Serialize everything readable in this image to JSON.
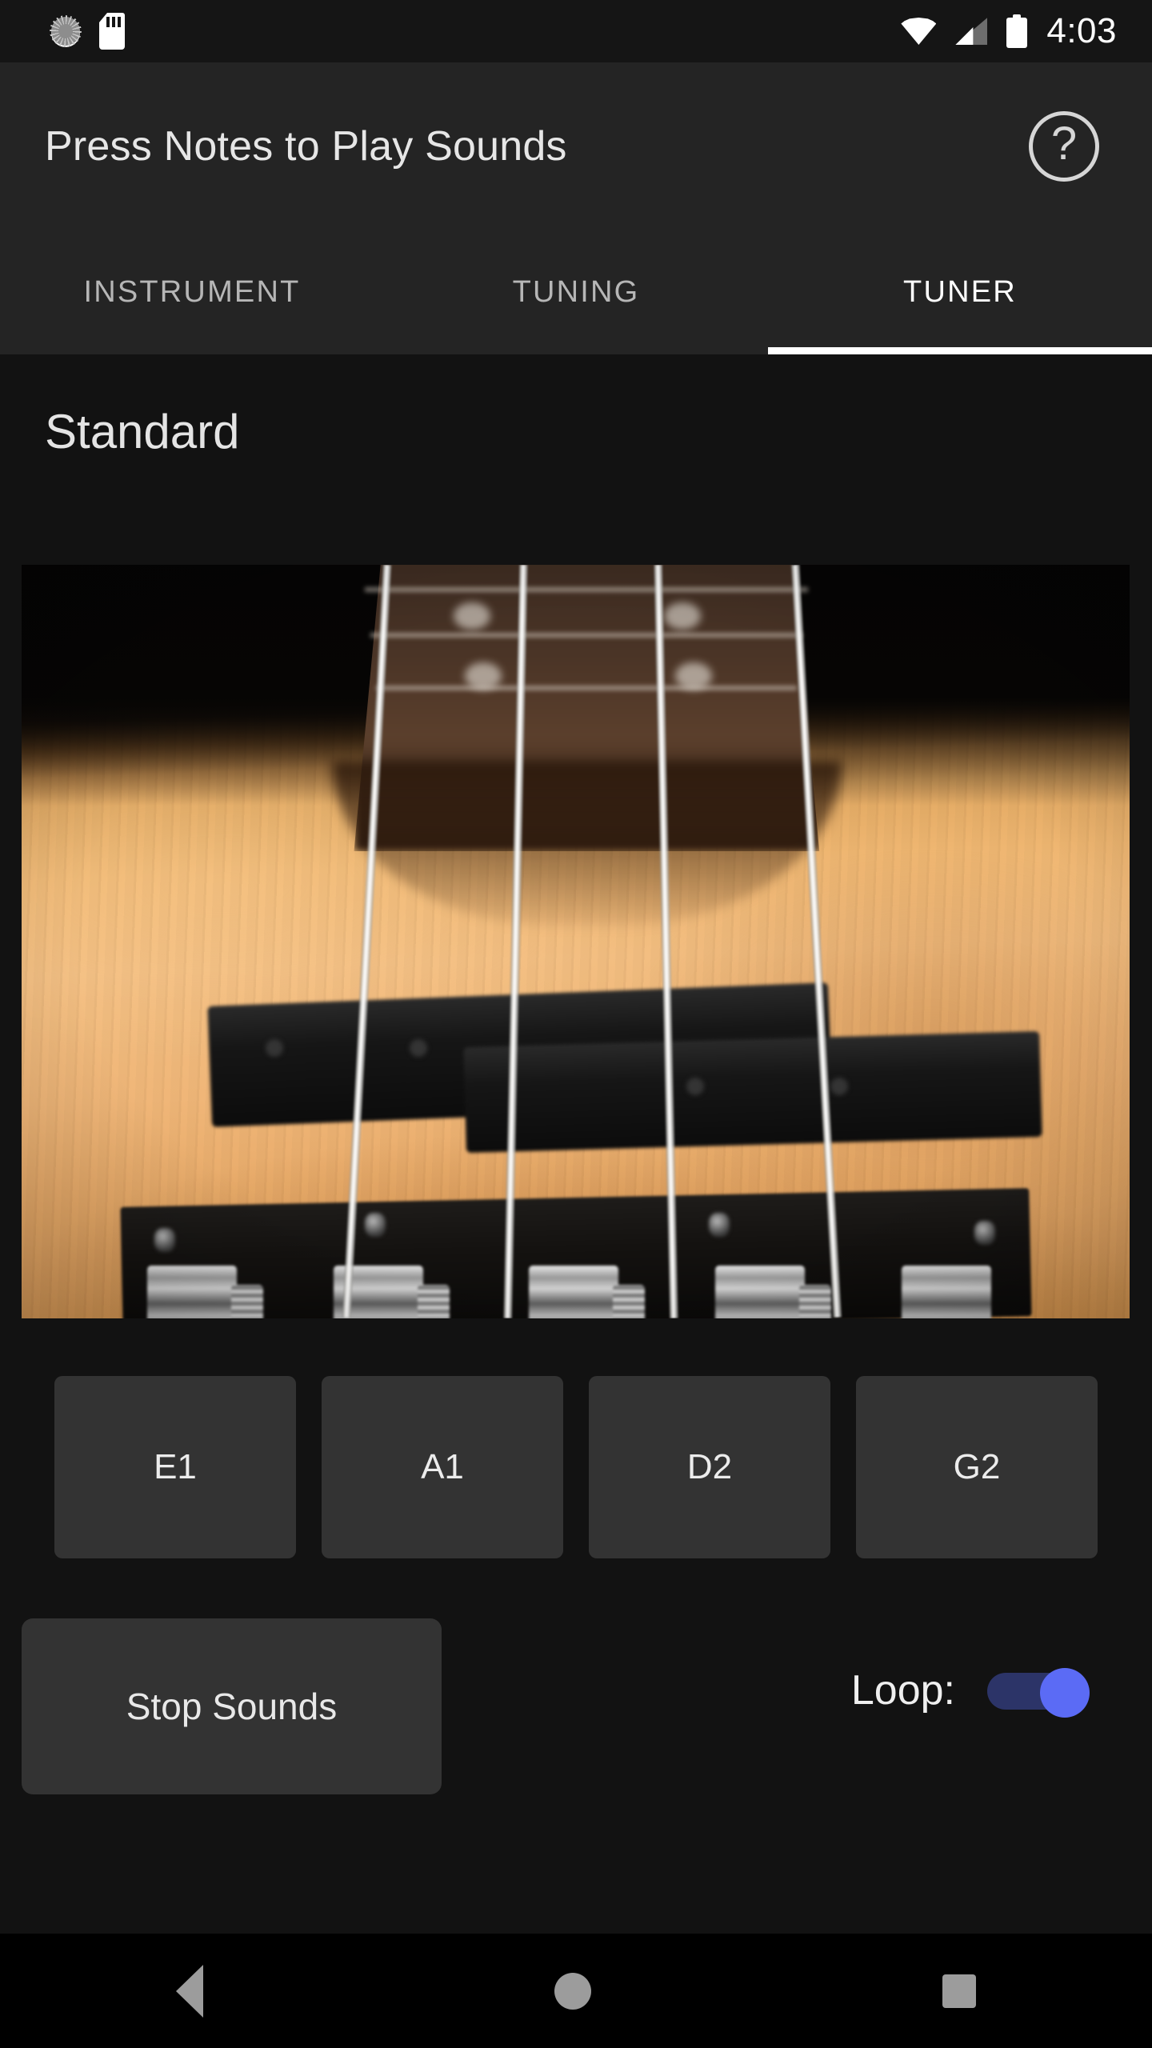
{
  "status_bar": {
    "time": "4:03",
    "icons_left": [
      "screenshot-icon",
      "sd-card-icon"
    ],
    "icons_right": [
      "wifi-icon",
      "cellular-signal-icon",
      "battery-icon"
    ]
  },
  "app_bar": {
    "title": "Press Notes to Play Sounds",
    "help_icon": "help-circle-icon",
    "help_glyph": "?"
  },
  "tabs": {
    "items": [
      {
        "label": "INSTRUMENT",
        "active": false
      },
      {
        "label": "TUNING",
        "active": false
      },
      {
        "label": "TUNER",
        "active": true
      }
    ],
    "active_index": 2
  },
  "main": {
    "tuning_name": "Standard",
    "instrument_photo": {
      "name": "bass-guitar-photo",
      "description": "Close-up photo of a four-string bass guitar body with natural maple finish, black pickups and chrome bridge saddles"
    },
    "note_buttons": [
      {
        "label": "E1"
      },
      {
        "label": "A1"
      },
      {
        "label": "D2"
      },
      {
        "label": "G2"
      }
    ],
    "stop_button_label": "Stop Sounds",
    "loop": {
      "label": "Loop:",
      "enabled": true
    }
  },
  "nav_bar": {
    "items": [
      "back-nav-button",
      "home-nav-button",
      "recent-apps-nav-button"
    ]
  },
  "colors": {
    "app_bar_bg": "#242424",
    "content_bg": "#121212",
    "button_bg": "#333333",
    "accent": "#5b6bf5",
    "toggle_track": "#2c3468",
    "tab_active": "#ffffff",
    "tab_inactive": "#b6b6b6"
  }
}
